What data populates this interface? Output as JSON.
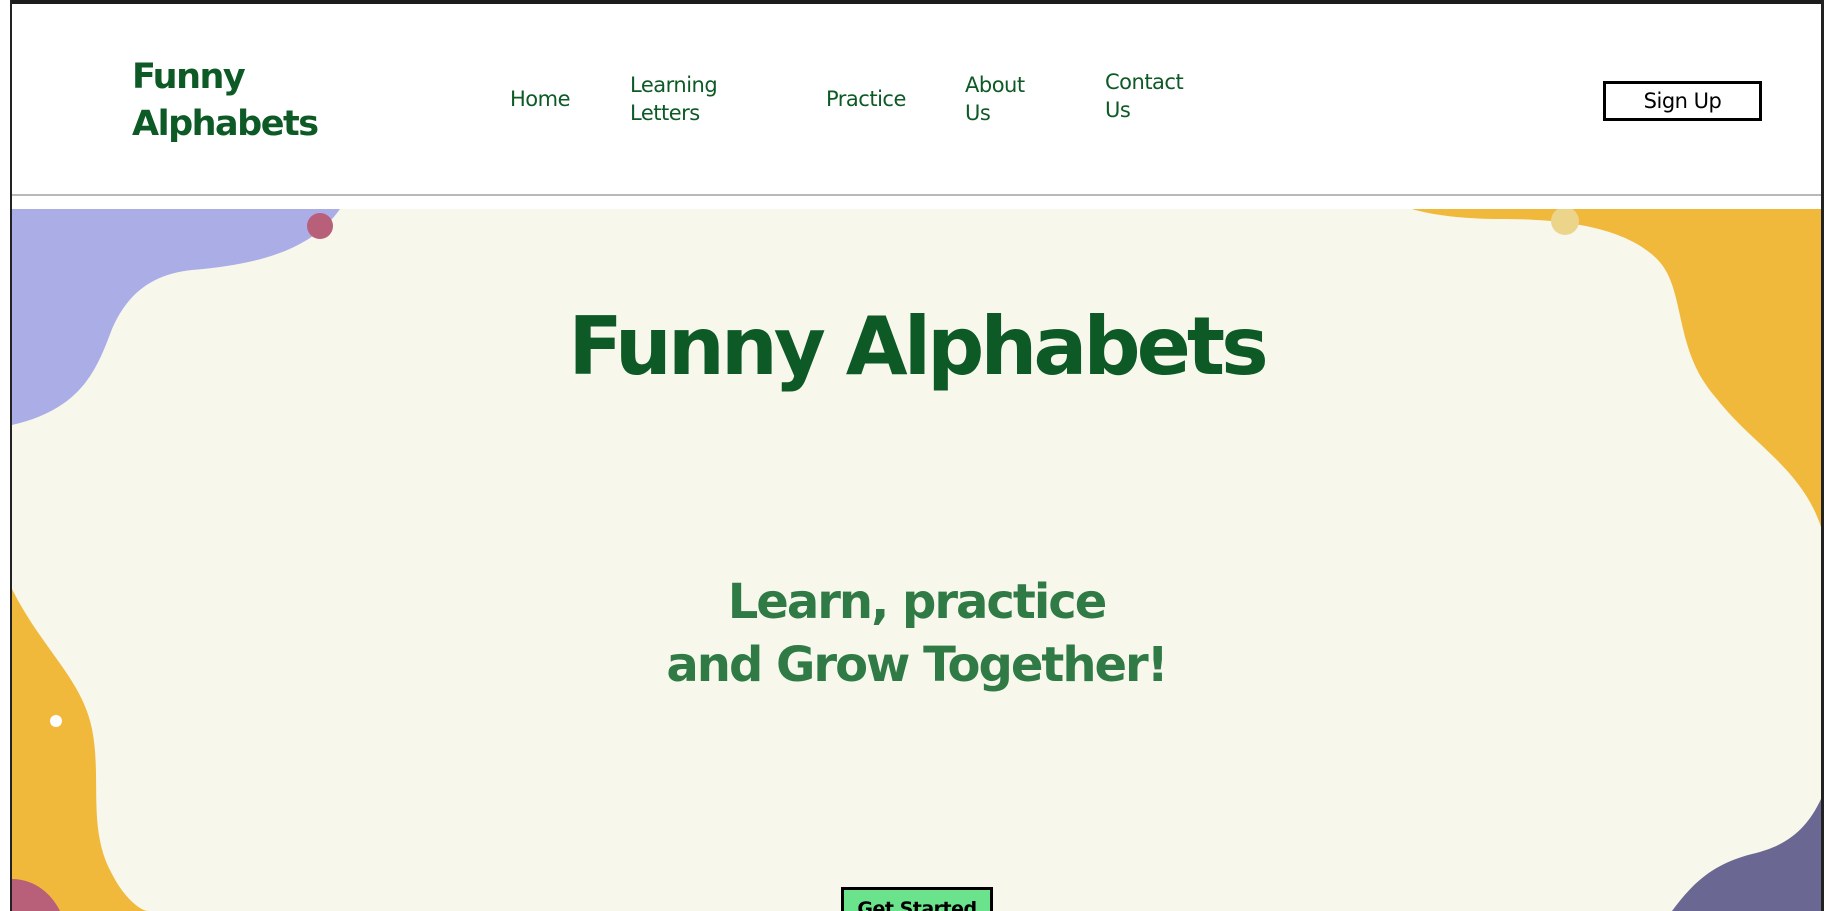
{
  "header": {
    "brand_line1": "Funny",
    "brand_line2": "Alphabets",
    "nav": [
      {
        "line1": "Home",
        "line2": ""
      },
      {
        "line1": "Learning",
        "line2": "Letters"
      },
      {
        "line1": "Practice",
        "line2": ""
      },
      {
        "line1": "About",
        "line2": "Us"
      },
      {
        "line1": "Contact",
        "line2": "Us"
      }
    ],
    "signup_label": "Sign Up"
  },
  "hero": {
    "title": "Funny Alphabets",
    "subtitle_line1": "Learn, practice",
    "subtitle_line2": "and Grow Together!",
    "cta_label": "Get Started"
  },
  "colors": {
    "brand_green": "#0d5a26",
    "subtitle_green": "#2f7a45",
    "hero_background": "#f7f7ec",
    "blob_lavender": "#abaee6",
    "blob_yellow": "#f1b93c",
    "blob_purple": "#6b6793",
    "blob_rose": "#b85f79",
    "cta_green": "#6be38c"
  }
}
